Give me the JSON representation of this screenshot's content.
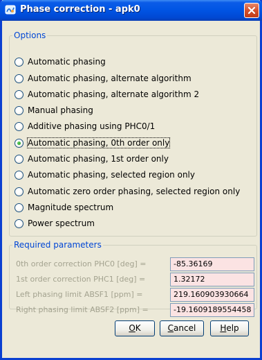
{
  "window": {
    "title": "Phase correction - apk0"
  },
  "options": {
    "legend": "Options",
    "items": [
      {
        "label": "Automatic phasing",
        "checked": false
      },
      {
        "label": "Automatic phasing, alternate algorithm",
        "checked": false
      },
      {
        "label": "Automatic phasing, alternate algorithm 2",
        "checked": false
      },
      {
        "label": "Manual phasing",
        "checked": false
      },
      {
        "label": "Additive phasing using PHC0/1",
        "checked": false
      },
      {
        "label": "Automatic phasing, 0th order only",
        "checked": true
      },
      {
        "label": "Automatic phasing, 1st order only",
        "checked": false
      },
      {
        "label": "Automatic phasing, selected region only",
        "checked": false
      },
      {
        "label": "Automatic zero order phasing, selected region only",
        "checked": false
      },
      {
        "label": "Magnitude spectrum",
        "checked": false
      },
      {
        "label": "Power spectrum",
        "checked": false
      }
    ]
  },
  "params": {
    "legend": "Required parameters",
    "rows": [
      {
        "label": "0th order correction PHC0 [deg] =",
        "value": "-85.36169"
      },
      {
        "label": "1st order correction PHC1 [deg] =",
        "value": "1.32172"
      },
      {
        "label": "Left phasing limit ABSF1 [ppm] =",
        "value": "219.160903930664"
      },
      {
        "label": "Right phasing limit ABSF2 [ppm] =",
        "value": "-19.1609189554458"
      }
    ]
  },
  "buttons": {
    "ok": {
      "mnemonic": "O",
      "rest": "K"
    },
    "cancel": {
      "mnemonic": "C",
      "rest": "ancel"
    },
    "help": {
      "mnemonic": "H",
      "rest": "elp"
    }
  },
  "colors": {
    "title_bar": "#0054e3",
    "legend_text": "#0046d5",
    "input_bg": "#fbe3e3",
    "dialog_bg": "#ece9d8",
    "radio_selected": "#1d8a1d",
    "close_button": "#d5502c"
  },
  "icons": {
    "app": "app-icon",
    "close": "close-icon"
  }
}
